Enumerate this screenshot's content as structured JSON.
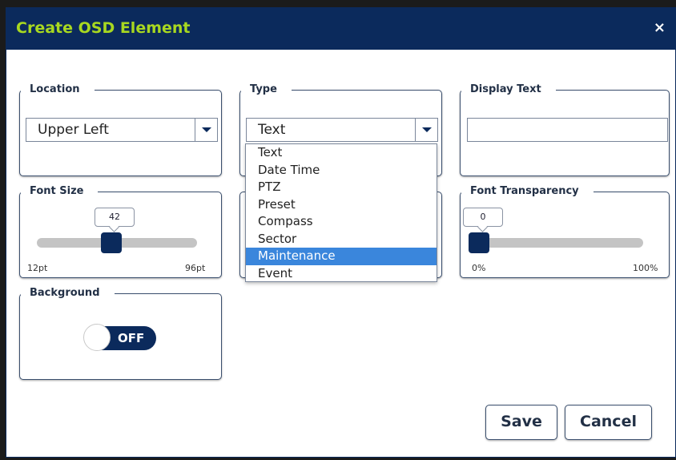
{
  "dialog": {
    "title": "Create OSD Element",
    "close_label": "×"
  },
  "location": {
    "legend": "Location",
    "selected": "Upper Left"
  },
  "type": {
    "legend": "Type",
    "selected": "Text",
    "options": [
      "Text",
      "Date Time",
      "PTZ",
      "Preset",
      "Compass",
      "Sector",
      "Maintenance",
      "Event"
    ],
    "highlighted": "Maintenance"
  },
  "display_text": {
    "legend": "Display Text",
    "value": ""
  },
  "font_size": {
    "legend": "Font Size",
    "value": "42",
    "min_label": "12pt",
    "max_label": "96pt",
    "fraction": 0.36
  },
  "font_transparency": {
    "legend": "Font Transparency",
    "value": "0",
    "min_label": "0%",
    "max_label": "100%",
    "fraction": 0
  },
  "background": {
    "legend": "Background",
    "toggle_label": "OFF"
  },
  "footer": {
    "save_label": "Save",
    "cancel_label": "Cancel"
  },
  "colors": {
    "header": "#0b2a5c",
    "title": "#a8d820",
    "highlight": "#3a86dc"
  }
}
